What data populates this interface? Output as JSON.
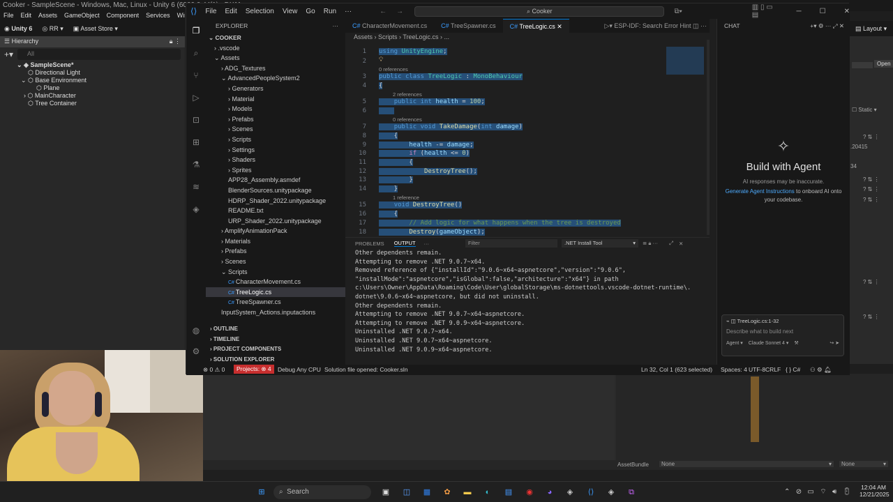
{
  "unity": {
    "title": "Cooker - SampleScene - Windows, Mac, Linux - Unity 6 (6000.0.44f1) <DX11>",
    "menu": [
      "File",
      "Edit",
      "Assets",
      "GameObject",
      "Component",
      "Services",
      "Window"
    ],
    "toolbar": {
      "account": "Unity 6",
      "rr": "RR",
      "asset_store": "Asset Store"
    },
    "hierarchy": {
      "label": "Hierarchy",
      "search_placeholder": "All",
      "scene": "SampleScene*",
      "items": [
        "Directional Light",
        "Base Environment",
        "Plane",
        "MainCharacter",
        "Tree Container"
      ]
    },
    "inspector": {
      "open": "Open",
      "static": "Static",
      "v1": ".20415",
      "v2": "34",
      "layout": "Layout"
    },
    "bottom": {
      "asset_bundle": "AssetBundle",
      "none1": "None",
      "none2": "None"
    }
  },
  "vscode": {
    "menu": [
      "File",
      "Edit",
      "Selection",
      "View",
      "Go",
      "Run",
      "···"
    ],
    "search": "Cooker",
    "activity_icons": [
      "files-icon",
      "search-icon",
      "source-control-icon",
      "run-debug-icon",
      "remote-icon",
      "extensions-icon",
      "testing-icon",
      "docker-icon",
      "unity-icon",
      "accounts-icon"
    ],
    "explorer": {
      "title": "EXPLORER",
      "root": "COOKER",
      "tree": [
        {
          "label": "› .vscode",
          "indent": 1,
          "type": "folder"
        },
        {
          "label": "⌄ Assets",
          "indent": 1,
          "type": "folder"
        },
        {
          "label": "› ADG_Textures",
          "indent": 2,
          "type": "folder"
        },
        {
          "label": "⌄ AdvancedPeopleSystem2",
          "indent": 2,
          "type": "folder"
        },
        {
          "label": "› Generators",
          "indent": 3,
          "type": "folder"
        },
        {
          "label": "› Material",
          "indent": 3,
          "type": "folder"
        },
        {
          "label": "› Models",
          "indent": 3,
          "type": "folder"
        },
        {
          "label": "› Prefabs",
          "indent": 3,
          "type": "folder"
        },
        {
          "label": "› Scenes",
          "indent": 3,
          "type": "folder"
        },
        {
          "label": "› Scripts",
          "indent": 3,
          "type": "folder"
        },
        {
          "label": "› Settings",
          "indent": 3,
          "type": "folder"
        },
        {
          "label": "› Shaders",
          "indent": 3,
          "type": "folder"
        },
        {
          "label": "› Sprites",
          "indent": 3,
          "type": "folder"
        },
        {
          "label": "APP28_Assembly.asmdef",
          "indent": 3,
          "type": "file"
        },
        {
          "label": "BlenderSources.unitypackage",
          "indent": 3,
          "type": "file"
        },
        {
          "label": "HDRP_Shader_2022.unitypackage",
          "indent": 3,
          "type": "file"
        },
        {
          "label": "README.txt",
          "indent": 3,
          "type": "file"
        },
        {
          "label": "URP_Shader_2022.unitypackage",
          "indent": 3,
          "type": "file"
        },
        {
          "label": "› AmplifyAnimationPack",
          "indent": 2,
          "type": "folder"
        },
        {
          "label": "› Materials",
          "indent": 2,
          "type": "folder"
        },
        {
          "label": "› Prefabs",
          "indent": 2,
          "type": "folder"
        },
        {
          "label": "› Scenes",
          "indent": 2,
          "type": "folder"
        },
        {
          "label": "⌄ Scripts",
          "indent": 2,
          "type": "folder"
        },
        {
          "label": "CharacterMovement.cs",
          "indent": 3,
          "type": "cs"
        },
        {
          "label": "TreeLogic.cs",
          "indent": 3,
          "type": "cs",
          "selected": true
        },
        {
          "label": "TreeSpawner.cs",
          "indent": 3,
          "type": "cs"
        },
        {
          "label": "InputSystem_Actions.inputactions",
          "indent": 2,
          "type": "file"
        }
      ],
      "sections": [
        "OUTLINE",
        "TIMELINE",
        "PROJECT COMPONENTS",
        "SOLUTION EXPLORER"
      ]
    },
    "tabs": [
      "CharacterMovement.cs",
      "TreeSpawner.cs",
      "TreeLogic.cs"
    ],
    "active_tab": "TreeLogic.cs",
    "run_hint": "ESP-IDF: Search Error Hint",
    "breadcrumb": "Assets › Scripts › TreeLogic.cs › ...",
    "code": {
      "line_numbers": [
        "1",
        "2",
        "3",
        "4",
        "5",
        "6",
        "7",
        "8",
        "9",
        "10",
        "11",
        "12",
        "13",
        "14",
        "15",
        "16",
        "17",
        "18"
      ],
      "refs": [
        "0 references",
        "2 references",
        "0 references",
        "1 reference"
      ]
    },
    "panel": {
      "tabs": [
        "PROBLEMS",
        "OUTPUT"
      ],
      "filter_placeholder": "Filter",
      "channel": ".NET Install Tool",
      "lines": [
        "Other dependents remain.",
        "Attempting to remove .NET 9.0.7~x64.",
        "Removed reference of {\"installId\":\"9.0.6~x64~aspnetcore\",\"version\":\"9.0.6\",",
        "\"installMode\":\"aspnetcore\",\"isGlobal\":false,\"architecture\":\"x64\"} in path",
        "c:\\Users\\Owner\\AppData\\Roaming\\Code\\User\\globalStorage\\ms-dotnettools.vscode-dotnet-runtime\\.",
        "dotnet\\9.0.6~x64~aspnetcore, but did not uninstall.",
        "Other dependents remain.",
        "Attempting to remove .NET 9.0.7~x64~aspnetcore.",
        "Attempting to remove .NET 9.0.9~x64~aspnetcore.",
        "Uninstalled .NET 9.0.7~x64.",
        "Uninstalled .NET 9.0.7~x64~aspnetcore.",
        "Uninstalled .NET 9.0.9~x64~aspnetcore."
      ]
    },
    "chat": {
      "title": "CHAT",
      "heading": "Build with Agent",
      "disclaimer": "AI responses may be inaccurate.",
      "link": "Generate Agent Instructions",
      "link_tail": "to onboard AI onto your codebase.",
      "context": "TreeLogic.cs:1-32",
      "input_placeholder": "Describe what to build next",
      "mode": "Agent",
      "model": "Claude Sonnet 4"
    },
    "status": {
      "errors": "0",
      "warnings": "0",
      "projects": "Projects: ⊗ 4",
      "debug": "Debug Any CPU",
      "solution": "Solution file opened: Cooker.sln",
      "position": "Ln 32, Col 1 (623 selected)",
      "spaces": "Spaces: 4",
      "encoding": "UTF-8",
      "eol": "CRLF",
      "lang": "{ } C#"
    }
  },
  "taskbar": {
    "search_placeholder": "Search",
    "time": "12:04 AM",
    "date": "12/21/2025"
  }
}
